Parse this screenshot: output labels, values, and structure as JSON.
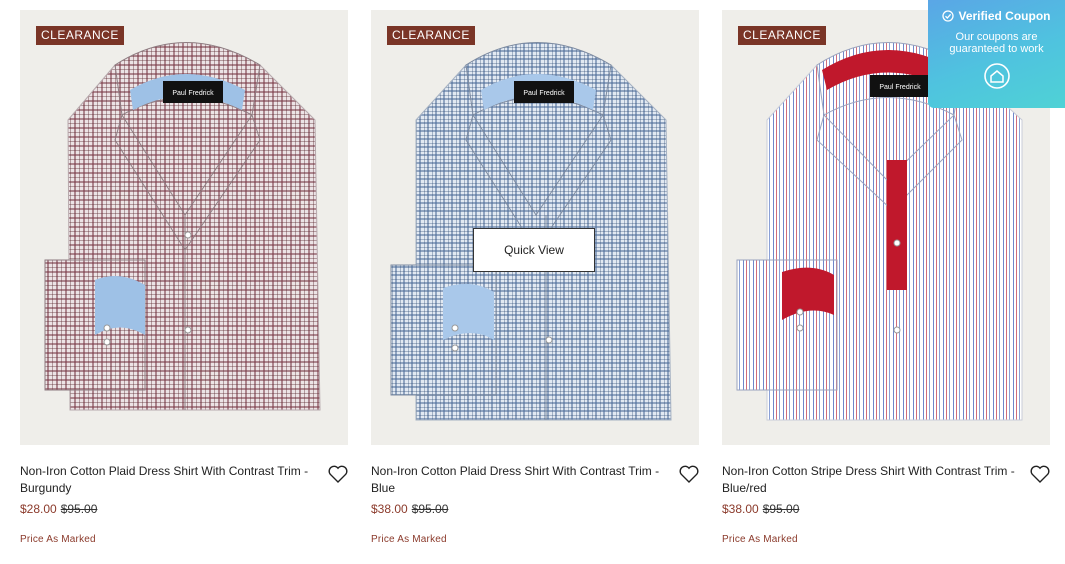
{
  "products": [
    {
      "badge": "CLEARANCE",
      "title": "Non-Iron Cotton Plaid Dress Shirt With Contrast Trim - Burgundy",
      "sale_price": "$28.00",
      "original_price": "$95.00",
      "note": "Price As Marked",
      "brand_label": "Paul Fredrick",
      "colors": {
        "base": "#e9dfe1",
        "line": "#7a3b46",
        "trim": "#9ec1e6"
      }
    },
    {
      "badge": "CLEARANCE",
      "title": "Non-Iron Cotton Plaid Dress Shirt With Contrast Trim - Blue",
      "sale_price": "$38.00",
      "original_price": "$95.00",
      "note": "Price As Marked",
      "brand_label": "Paul Fredrick",
      "quick_view": "Quick View",
      "colors": {
        "base": "#dfe7f1",
        "line": "#4e6d99",
        "trim": "#a9c8ea"
      }
    },
    {
      "badge": "CLEARANCE",
      "title": "Non-Iron Cotton Stripe Dress Shirt With Contrast Trim - Blue/red",
      "sale_price": "$38.00",
      "original_price": "$95.00",
      "note": "Price As Marked",
      "brand_label": "Paul Fredrick",
      "colors": {
        "base": "#ffffff",
        "line": "#7e8fc7",
        "trim": "#c0182c"
      }
    }
  ],
  "coupon": {
    "heading": "Verified Coupon",
    "subtext": "Our coupons are guaranteed to work",
    "icon": "house-tag-icon"
  }
}
